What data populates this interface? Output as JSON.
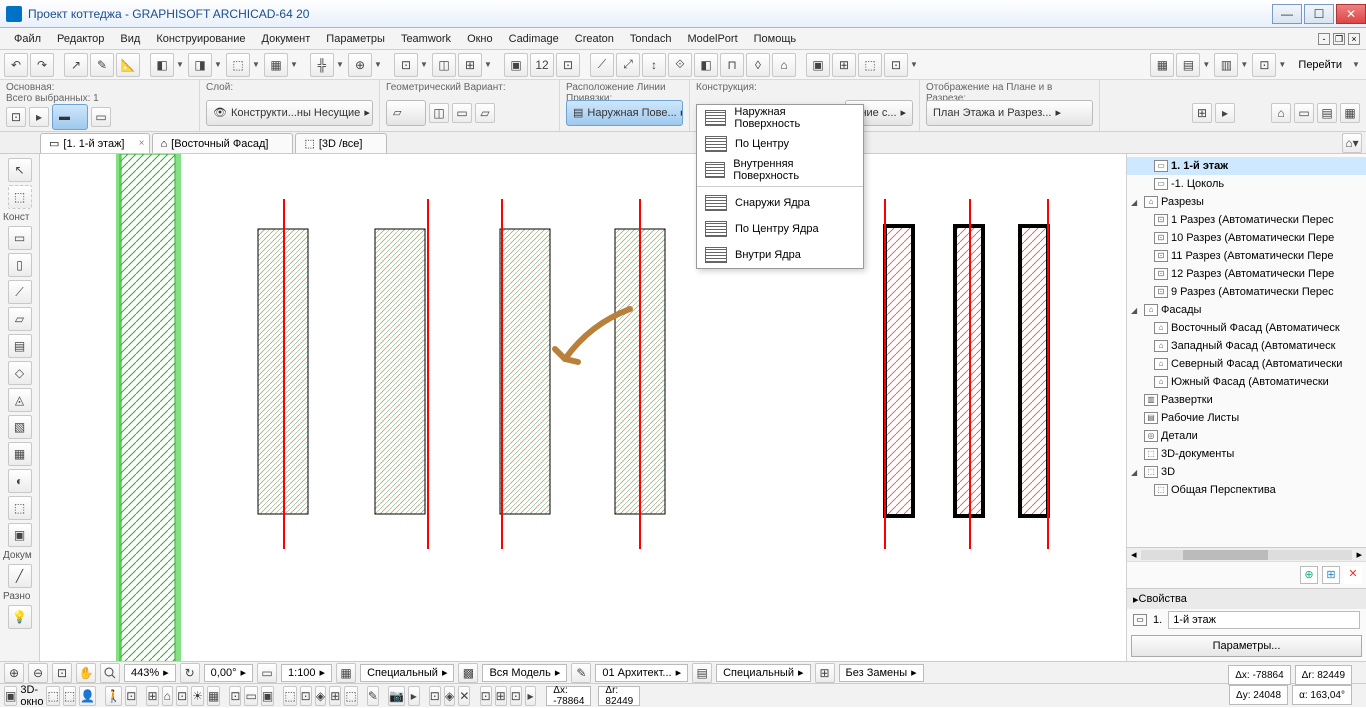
{
  "title": "Проект коттеджа - GRAPHISOFT ARCHICAD-64 20",
  "menu": [
    "Файл",
    "Редактор",
    "Вид",
    "Конструирование",
    "Документ",
    "Параметры",
    "Teamwork",
    "Окно",
    "Cadimage",
    "Creaton",
    "Tondach",
    "ModelPort",
    "Помощь"
  ],
  "toolbar_right_label": "Перейти",
  "info": {
    "sec1_lbl": "Основная:",
    "sec1_sub": "Всего выбранных: 1",
    "sec2_lbl": "Слой:",
    "sec2_val": "Конструкти...ны Несущие",
    "sec3_lbl": "Геометрический Вариант:",
    "sec4_lbl": "Расположение Линии Привязки:",
    "sec4_val": "Наружная Пове...",
    "sec5_lbl": "Конструкция:",
    "sec5_val": "шние с...",
    "sec6_lbl": "Отображение на Плане и в Разрезе:",
    "sec6_val": "План Этажа и Разрез..."
  },
  "tabs": {
    "t1": "[1. 1-й этаж]",
    "t2": "[Восточный Фасад]",
    "t3": "[3D /все]"
  },
  "dropdown": {
    "i1": "Наружная Поверхность",
    "i2": "По Центру",
    "i3": "Внутренняя Поверхность",
    "i4": "Снаружи Ядра",
    "i5": "По Центру Ядра",
    "i6": "Внутри Ядра"
  },
  "left_labels": {
    "konst": "Конст",
    "dokum": "Докум",
    "razno": "Разно"
  },
  "nav": {
    "n1": "1. 1-й этаж",
    "n2": "-1. Цоколь",
    "n3": "Разрезы",
    "n4": "1 Разрез (Автоматически Перес",
    "n5": "10 Разрез (Автоматически Пере",
    "n6": "11 Разрез (Автоматически Пере",
    "n7": "12 Разрез (Автоматически Пере",
    "n8": "9 Разрез (Автоматически Перес",
    "n9": "Фасады",
    "n10": "Восточный Фасад (Автоматическ",
    "n11": "Западный Фасад (Автоматическ",
    "n12": "Северный Фасад (Автоматически",
    "n13": "Южный Фасад (Автоматически",
    "n14": "Развертки",
    "n15": "Рабочие Листы",
    "n16": "Детали",
    "n17": "3D-документы",
    "n18": "3D",
    "n19": "Общая Перспектива"
  },
  "props": {
    "hdr": "Свойства",
    "id": "1.",
    "name": "1-й этаж",
    "btn": "Параметры..."
  },
  "status": {
    "zoom": "443%",
    "angle": "0,00°",
    "scale": "1:100",
    "s1": "Специальный",
    "s2": "Вся Модель",
    "s3": "01 Архитект...",
    "s4": "Специальный",
    "s5": "Без Замены",
    "c1": "Δx: -78864",
    "c2": "Δr: 82449",
    "c3": "Δy: 24048",
    "c4": "α: 163,04°",
    "bottom_label": "3D-окно"
  }
}
